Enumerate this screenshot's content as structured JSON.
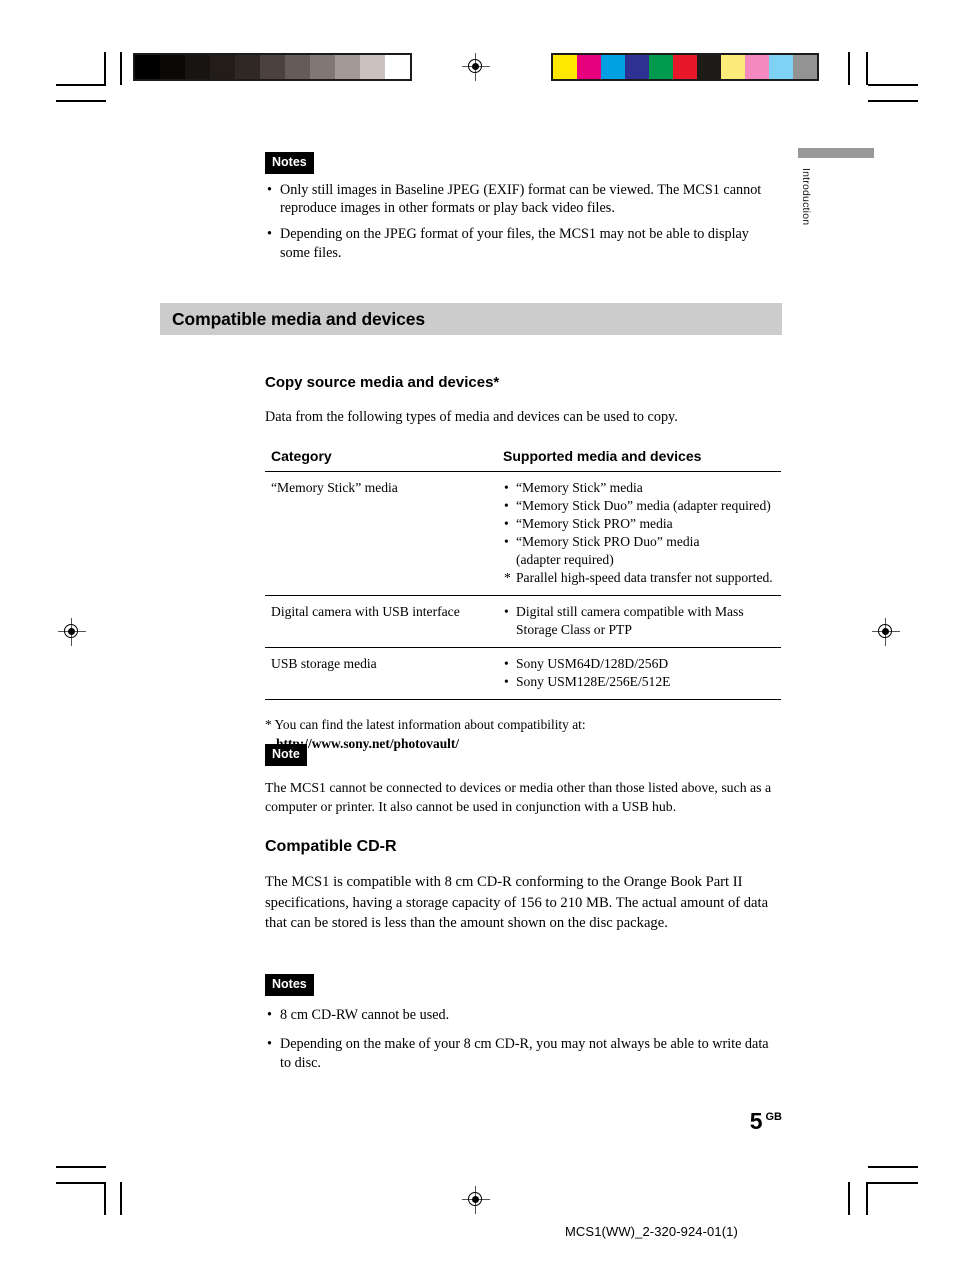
{
  "marks": {
    "grayscale_wedge": [
      "#000000",
      "#0b0908",
      "#181412",
      "#231d1a",
      "#302825",
      "#4b413d",
      "#655b57",
      "#827873",
      "#a49a95",
      "#ccc2bd",
      "#ffffff"
    ],
    "color_wedge": [
      "#ffe800",
      "#e6007e",
      "#00a0e3",
      "#2e3192",
      "#009a4e",
      "#e8172a",
      "#1d1a18",
      "#fbeb78",
      "#f489c0",
      "#7ed3f5",
      "#939393"
    ],
    "registration_mark_name": "registration-target"
  },
  "tab": {
    "label": "Introduction",
    "bar_color": "#999999"
  },
  "notes_top": {
    "badge": "Notes",
    "items": [
      "Only still images in Baseline JPEG (EXIF) format can be viewed. The MCS1 cannot reproduce images in other formats or play back video files.",
      "Depending on the JPEG format of your files, the MCS1 may not be able to display some files."
    ]
  },
  "banner": {
    "title": "Compatible media and devices",
    "background": "#cccccc"
  },
  "section_copy_source": {
    "heading": "Copy source media and devices*",
    "intro": "Data from the following types of media and devices can be used to copy.",
    "table": {
      "headers": [
        "Category",
        "Supported media and devices"
      ],
      "rows": [
        {
          "category": "“Memory Stick” media",
          "items": [
            {
              "marker": "bullet",
              "text": "“Memory Stick” media"
            },
            {
              "marker": "bullet",
              "text": "“Memory Stick Duo” media (adapter required)"
            },
            {
              "marker": "bullet",
              "text": "“Memory Stick PRO” media"
            },
            {
              "marker": "bullet",
              "text": "“Memory Stick PRO Duo” media"
            },
            {
              "marker": "none",
              "text": "(adapter required)"
            },
            {
              "marker": "star",
              "text": "Parallel high-speed data transfer not supported."
            }
          ]
        },
        {
          "category": "Digital camera with USB interface",
          "items": [
            {
              "marker": "bullet",
              "text": "Digital still camera compatible with Mass Storage Class or PTP"
            }
          ]
        },
        {
          "category": "USB storage media",
          "items": [
            {
              "marker": "bullet",
              "text": "Sony USM64D/128D/256D"
            },
            {
              "marker": "bullet",
              "text": "Sony USM128E/256E/512E"
            }
          ]
        }
      ]
    },
    "footnote": "* You can find the latest information about compatibility at:",
    "footnote_url": "http://www.sony.net/photovault/"
  },
  "note_middle": {
    "badge": "Note",
    "text": "The MCS1 cannot be connected to devices or media other than those listed above, such as a computer or printer. It also cannot be used in conjunction with a USB hub."
  },
  "section_cdr": {
    "heading": "Compatible CD-R",
    "body": "The MCS1 is compatible with 8 cm CD-R conforming to the Orange Book Part II specifications, having a storage capacity of 156 to 210 MB. The actual amount of data that can be stored is less than the amount shown on the disc package.",
    "notes_badge": "Notes",
    "notes": [
      "8 cm CD-RW cannot be used.",
      "Depending on the make of your 8 cm CD-R, you may not always be able to write data to disc."
    ]
  },
  "footer": {
    "page_number": "5",
    "page_locale": "GB",
    "document_code": "MCS1(WW)_2-320-924-01(1)"
  }
}
